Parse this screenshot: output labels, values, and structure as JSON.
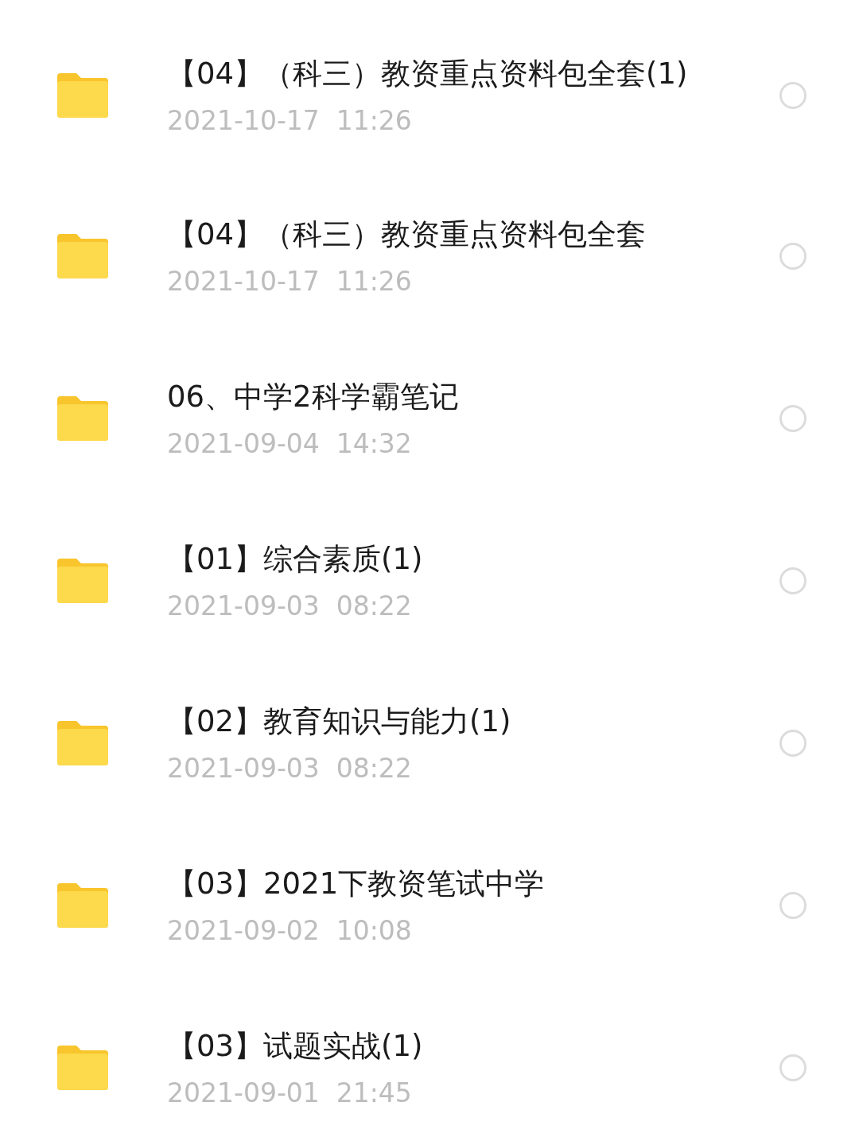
{
  "files": [
    {
      "name": "【04】（科三）教资重点资料包全套(1)",
      "date": "2021-10-17  11:26",
      "selected": false
    },
    {
      "name": "【04】（科三）教资重点资料包全套",
      "date": "2021-10-17  11:26",
      "selected": false
    },
    {
      "name": "06、中学2科学霸笔记",
      "date": "2021-09-04  14:32",
      "selected": false
    },
    {
      "name": "【01】综合素质(1)",
      "date": "2021-09-03  08:22",
      "selected": false
    },
    {
      "name": "【02】教育知识与能力(1)",
      "date": "2021-09-03  08:22",
      "selected": false
    },
    {
      "name": "【03】2021下教资笔试中学",
      "date": "2021-09-02  10:08",
      "selected": false
    },
    {
      "name": "【03】试题实战(1)",
      "date": "2021-09-01  21:45",
      "selected": false
    }
  ]
}
